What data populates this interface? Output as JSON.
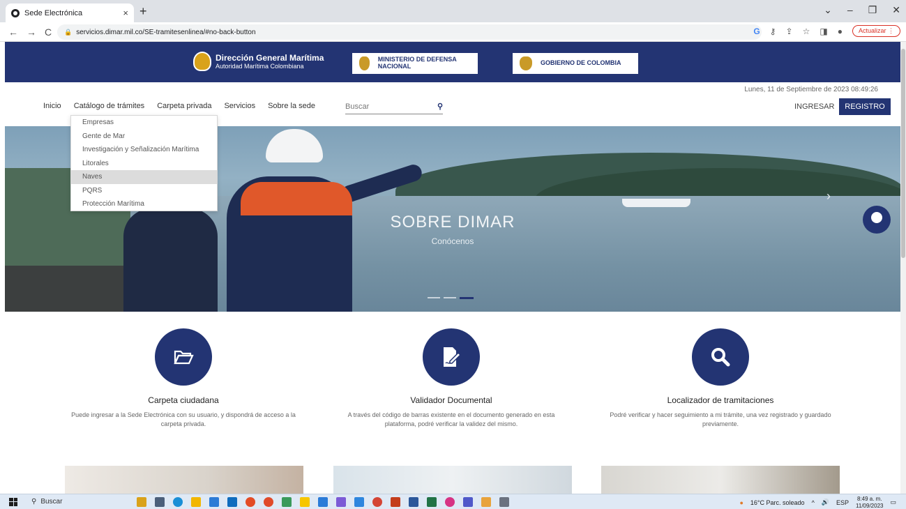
{
  "browser": {
    "tab_title": "Sede Electrónica",
    "tab_close": "×",
    "new_tab": "+",
    "url": "servicios.dimar.mil.co/SE-tramitesenlinea/#no-back-button",
    "update_label": "Actualizar",
    "window_controls": [
      "⌄",
      "–",
      "❐",
      "✕"
    ]
  },
  "header": {
    "org_name": "Dirección General Marítima",
    "org_sub": "Autoridad Marítima Colombiana",
    "ministry": "MINISTERIO DE DEFENSA NACIONAL",
    "government": "GOBIERNO DE COLOMBIA"
  },
  "nav": {
    "date": "Lunes, 11 de Septiembre de 2023 08:49:26",
    "menu": [
      "Inicio",
      "Catálogo de trámites",
      "Carpeta privada",
      "Servicios",
      "Sobre la sede"
    ],
    "search_placeholder": "Buscar",
    "login": "INGRESAR",
    "register": "REGISTRO"
  },
  "dropdown": {
    "items": [
      "Empresas",
      "Gente de Mar",
      "Investigación y Señalización Marítima",
      "Litorales",
      "Naves",
      "PQRS",
      "Protección Marítima"
    ],
    "hovered": "Naves"
  },
  "hero": {
    "title": "SOBRE DIMAR",
    "subtitle": "Conócenos",
    "slide_count": 3,
    "active_slide": 3
  },
  "features": [
    {
      "title": "Carpeta ciudadana",
      "desc": "Puede ingresar a la Sede Electrónica con su usuario, y dispondrá de acceso a la carpeta privada.",
      "icon": "folder-open-icon"
    },
    {
      "title": "Validador Documental",
      "desc": "A través del código de barras existente en el documento generado en esta plataforma, podré verificar la validez del mismo.",
      "icon": "document-sign-icon"
    },
    {
      "title": "Localizador de tramitaciones",
      "desc": "Podré verificar y hacer seguimiento a mi trámite, una vez registrado y guardado previamente.",
      "icon": "search-icon"
    }
  ],
  "taskbar": {
    "search": "Buscar",
    "weather": "16°C Parc. soleado",
    "lang": "ESP",
    "time": "8:49 a. m.",
    "date": "11/09/2023"
  },
  "colors": {
    "brand": "#233473",
    "accent_update": "#d93025"
  }
}
